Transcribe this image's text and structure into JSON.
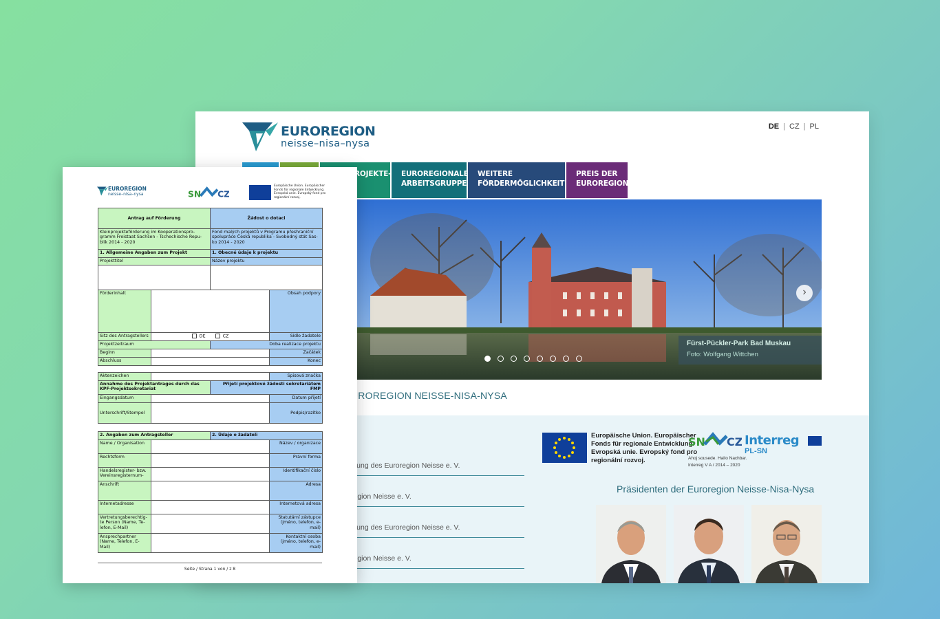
{
  "site": {
    "logo": {
      "title": "EUROREGION",
      "subtitle": "neisse–nisa–nysa"
    },
    "languages": {
      "de": "DE",
      "cz": "CZ",
      "pl": "PL",
      "separator": "|"
    },
    "nav": [
      {
        "label_line1": "",
        "label_line2": "",
        "color": "#2a9bd0"
      },
      {
        "label_line1": "",
        "label_line2": "",
        "color": "#7aaa3a"
      },
      {
        "label_line1": "ROJEKTE-",
        "label_line2": "",
        "color": "#1a9070"
      },
      {
        "label_line1": "EUROREGIONALE",
        "label_line2": "ARBEITSGRUPPEN",
        "color": "#13707a"
      },
      {
        "label_line1": "WEITERE",
        "label_line2": "FÖRDERMÖGLICHKEITEN",
        "color": "#274a7a"
      },
      {
        "label_line1": "PREIS DER",
        "label_line2": "EUROREGION",
        "color": "#6b2c78"
      }
    ],
    "slider": {
      "caption_title": "Fürst-Pückler-Park Bad Muskau",
      "caption_credit": "Foto: Wolfgang Wittchen",
      "next_symbol": "›",
      "dot_count": 8,
      "active_dot": 1
    },
    "welcome_title": "UROREGION NEISSE-NISA-NYSA",
    "news": [
      "nlung des Euroregion Neisse e. V.",
      "region Neisse e. V.",
      "nlung des Euroregion Neisse e. V.",
      "region Neisse e. V."
    ],
    "funding": {
      "eu_text": [
        "Europäische Union. Europäischer",
        "Fonds für regionale Entwicklung.",
        "Evropská unie. Evropský fond pro",
        "regionální rozvoj."
      ],
      "sncz_lines": [
        "Ahoj sousede. Hallo Nachbar.",
        "Interreg V A / 2014 – 2020"
      ],
      "interreg_title": "Interreg",
      "interreg_sub": "PL-SN"
    },
    "presidents_title": "Präsidenten der Euroregion Neisse-Nisa-Nysa"
  },
  "form": {
    "header_logo": {
      "title": "EUROREGION",
      "subtitle": "neisse–nisa–nysa"
    },
    "header_eu_text": "Europäische Union. Europäischer Fonds für regionale Entwicklung. Evropská unie. Evropský fond pro regionální rozvoj.",
    "title_de": "Antrag auf Förderung",
    "title_cz": "Žádost o dotaci",
    "program_de": "Kleinprojekteförderung im Kooperationspro-gramm Freistaat Sachsen - Tschechische Repu-blik 2014 - 2020",
    "program_cz": "Fond malých projektů v Programu přeshraniční spolupráce Česká republika - Svobodný stát Sas-ko 2014 - 2020",
    "s1_de": "1. Allgemeine Angaben zum Projekt",
    "s1_cz": "1. Obecné údaje k projektu",
    "projekttitel": "Projekttitel",
    "nazev_projektu": "Název projektu",
    "foerderinhalt": "Förderinhalt",
    "obsah_podpory": "Obsah podpory",
    "sitz": "Sitz des Antragstellers",
    "check_de": "DE",
    "check_cz": "CZ",
    "sidlo": "Sídlo žadatele",
    "projektzeitraum": "Projektzeitraum",
    "doba_realizace": "Doba realizace projektu",
    "beginn": "Beginn",
    "zacatek": "Začátek",
    "abschluss": "Abschluss",
    "konec": "Konec",
    "aktenzeichen": "Aktenzeichen",
    "spisova_znacka": "Spisová značka",
    "annahme_de": "Annahme des Projektantrages durch das KPF-Projektsekretariat",
    "annahme_cz": "Přijetí projektové žádosti sekretariátem FMP",
    "eingangsdatum": "Eingangsdatum",
    "datum_prijeti": "Datum přijetí",
    "unterschrift": "Unterschrift/Stempel",
    "podpis": "Podpis/razítko",
    "s2_de": "2. Angaben zum Antragsteller",
    "s2_cz": "2. Údaje o žadateli",
    "rows2": [
      {
        "de": "Name / Organisation",
        "cz": "Název / organizace"
      },
      {
        "de": "Rechtsform",
        "cz": "Právní forma"
      },
      {
        "de": "Handelsregister- bzw. Vereinsregisternum-",
        "cz": "Identifikační číslo"
      },
      {
        "de": "Anschrift",
        "cz": "Adresa"
      },
      {
        "de": "Internetadresse",
        "cz": "Internetová adresa"
      },
      {
        "de": "Vertretungsberechtig-te Person (Name, Te-lefon, E-Mail)",
        "cz": "Statutární zástupce (jméno, telefon, e-mail)"
      },
      {
        "de": "Ansprechpartner (Name, Telefon, E-Mail)",
        "cz": "Kontaktní osoba (jméno, telefon, e-mail)"
      }
    ],
    "footer": "Seite / Strana 1 von / z 8"
  }
}
